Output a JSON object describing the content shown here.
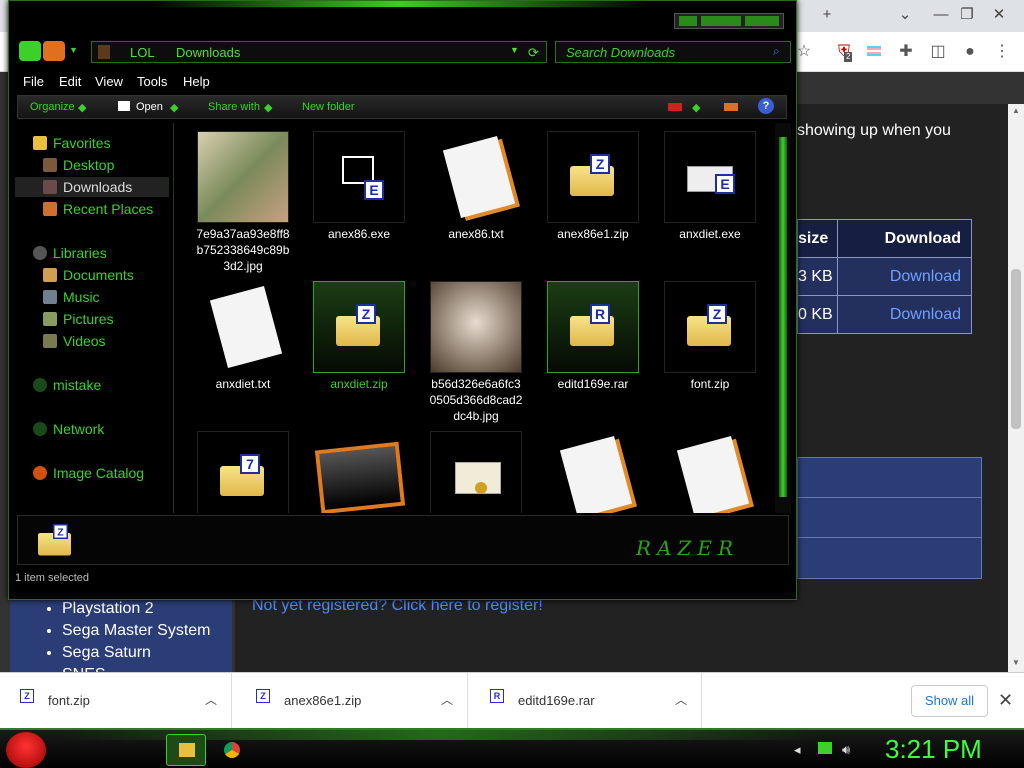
{
  "browser": {
    "tab_actions": {
      "new_tab": "+",
      "tab_list": "⌄",
      "minimize": "—",
      "restore": "❐",
      "close": "✕"
    },
    "ext_badge": "2"
  },
  "page": {
    "intro_text": "showing up when you",
    "table": {
      "headers": [
        "size",
        "Download"
      ],
      "rows": [
        {
          "size": "3 KB",
          "link": "Download"
        },
        {
          "size": "0 KB",
          "link": "Download"
        }
      ]
    },
    "register_link": "Not yet registered? Click here to register!",
    "nav_items": [
      "Playstation 2",
      "Sega Master System",
      "Sega Saturn",
      "SNES"
    ]
  },
  "explorer": {
    "breadcrumb": [
      "LOL",
      "Downloads"
    ],
    "search_placeholder": "Search Downloads",
    "menu": [
      "File",
      "Edit",
      "View",
      "Tools",
      "Help"
    ],
    "commands": {
      "organize": "Organize",
      "open": "Open",
      "share": "Share with",
      "new_folder": "New folder"
    },
    "sidebar": {
      "favorites": "Favorites",
      "desktop": "Desktop",
      "downloads": "Downloads",
      "recent": "Recent Places",
      "libraries": "Libraries",
      "documents": "Documents",
      "music": "Music",
      "pictures": "Pictures",
      "videos": "Videos",
      "mistake": "mistake",
      "network": "Network",
      "image_catalog": "Image Catalog"
    },
    "files": [
      {
        "name": "7e9a37aa93e8ff8b752338649c89b3d2.jpg"
      },
      {
        "name": "anex86.exe"
      },
      {
        "name": "anex86.txt"
      },
      {
        "name": "anex86e1.zip"
      },
      {
        "name": "anxdiet.exe"
      },
      {
        "name": "anxdiet.txt"
      },
      {
        "name": "anxdiet.zip"
      },
      {
        "name": "b56d326e6a6fc30505d366d8cad2dc4b.jpg"
      },
      {
        "name": "editd169e.rar"
      },
      {
        "name": "font.zip"
      },
      {
        "name": ""
      },
      {
        "name": ""
      },
      {
        "name": ""
      },
      {
        "name": ""
      },
      {
        "name": ""
      }
    ],
    "brand": "RAZER",
    "status": "1 item selected"
  },
  "downloads": {
    "items": [
      {
        "name": "font.zip",
        "icon": "Z"
      },
      {
        "name": "anex86e1.zip",
        "icon": "Z"
      },
      {
        "name": "editd169e.rar",
        "icon": "R"
      }
    ],
    "show_all": "Show all",
    "close": "✕"
  },
  "taskbar": {
    "clock": "3:21 PM"
  },
  "colors": {
    "accent_green": "#3bd12a",
    "link_blue": "#4e8cff",
    "table_blue": "#2b3d77"
  }
}
